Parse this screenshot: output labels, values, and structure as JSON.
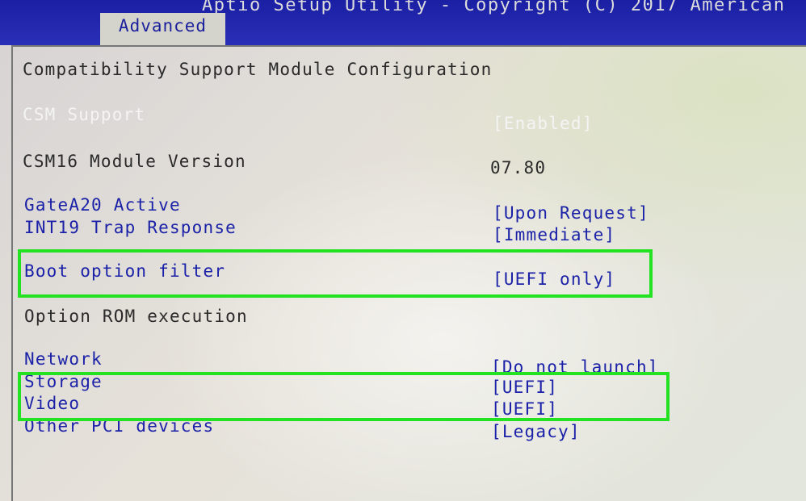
{
  "header": {
    "title": "Aptio Setup Utility - Copyright (C) 2017 American",
    "active_tab": "Advanced"
  },
  "section_title": "Compatibility Support Module Configuration",
  "items": [
    {
      "label": "CSM Support",
      "value": "[Enabled]"
    },
    {
      "label": "CSM16 Module Version",
      "value": "07.80"
    },
    {
      "label": "GateA20 Active",
      "value": "[Upon Request]"
    },
    {
      "label": "INT19 Trap Response",
      "value": "[Immediate]"
    },
    {
      "label": "Boot option filter",
      "value": "[UEFI only]"
    },
    {
      "label": "Option ROM execution",
      "value": ""
    },
    {
      "label": "Network",
      "value": "[Do not launch]"
    },
    {
      "label": "Storage",
      "value": "[UEFI]"
    },
    {
      "label": "Video",
      "value": "[UEFI]"
    },
    {
      "label": "Other PCI devices",
      "value": "[Legacy]"
    }
  ],
  "colors": {
    "header_bg": "#1a1fa3",
    "highlight": "#22e222",
    "value_text": "#1b22a8",
    "selected_text": "#f4f4f4"
  }
}
